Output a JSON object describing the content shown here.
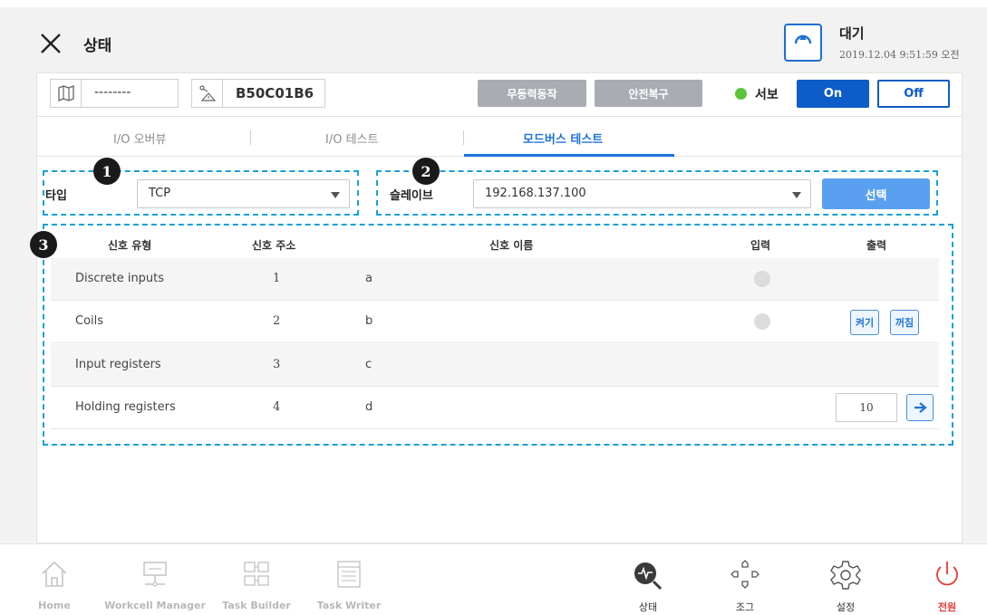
{
  "header": {
    "title": "상태",
    "status_label": "대기",
    "status_datetime": "2019.12.04 9:51:59 오전"
  },
  "toolbar": {
    "workcell_value": "--------",
    "robot_value": "B50C01B6",
    "btn_free_drive": "무등력동작",
    "btn_safety_recovery": "안전복구",
    "servo_label": "서보",
    "on_label": "On",
    "off_label": "Off",
    "servo_color": "#5cc43a"
  },
  "tabs": [
    {
      "label": "I/O 오버뷰",
      "active": false
    },
    {
      "label": "I/O 테스트",
      "active": false
    },
    {
      "label": "모드버스 테스트",
      "active": true
    }
  ],
  "badges": [
    "1",
    "2",
    "3"
  ],
  "type_field": {
    "label": "타입",
    "value": "TCP"
  },
  "slave_field": {
    "label": "슬레이브",
    "value": "192.168.137.100",
    "select_button": "선택"
  },
  "table": {
    "headers": {
      "signal_type": "신호 유형",
      "signal_address": "신호 주소",
      "signal_name": "신호 이름",
      "input": "입력",
      "output": "출력"
    },
    "rows": [
      {
        "type": "Discrete inputs",
        "address": "1",
        "name": "a"
      },
      {
        "type": "Coils",
        "address": "2",
        "name": "b",
        "on_btn": "켜기",
        "off_btn": "꺼짐"
      },
      {
        "type": "Input registers",
        "address": "3",
        "name": "c"
      },
      {
        "type": "Holding registers",
        "address": "4",
        "name": "d",
        "value": "10"
      }
    ]
  },
  "bottom_nav": {
    "home": "Home",
    "workcell_manager": "Workcell Manager",
    "task_builder": "Task Builder",
    "task_writer": "Task Writer",
    "status": "상태",
    "jog": "조그",
    "settings": "설정",
    "power": "전원"
  },
  "colors": {
    "accent": "#1e73d8",
    "dashed": "#1aa0d8",
    "power": "#e53935"
  }
}
